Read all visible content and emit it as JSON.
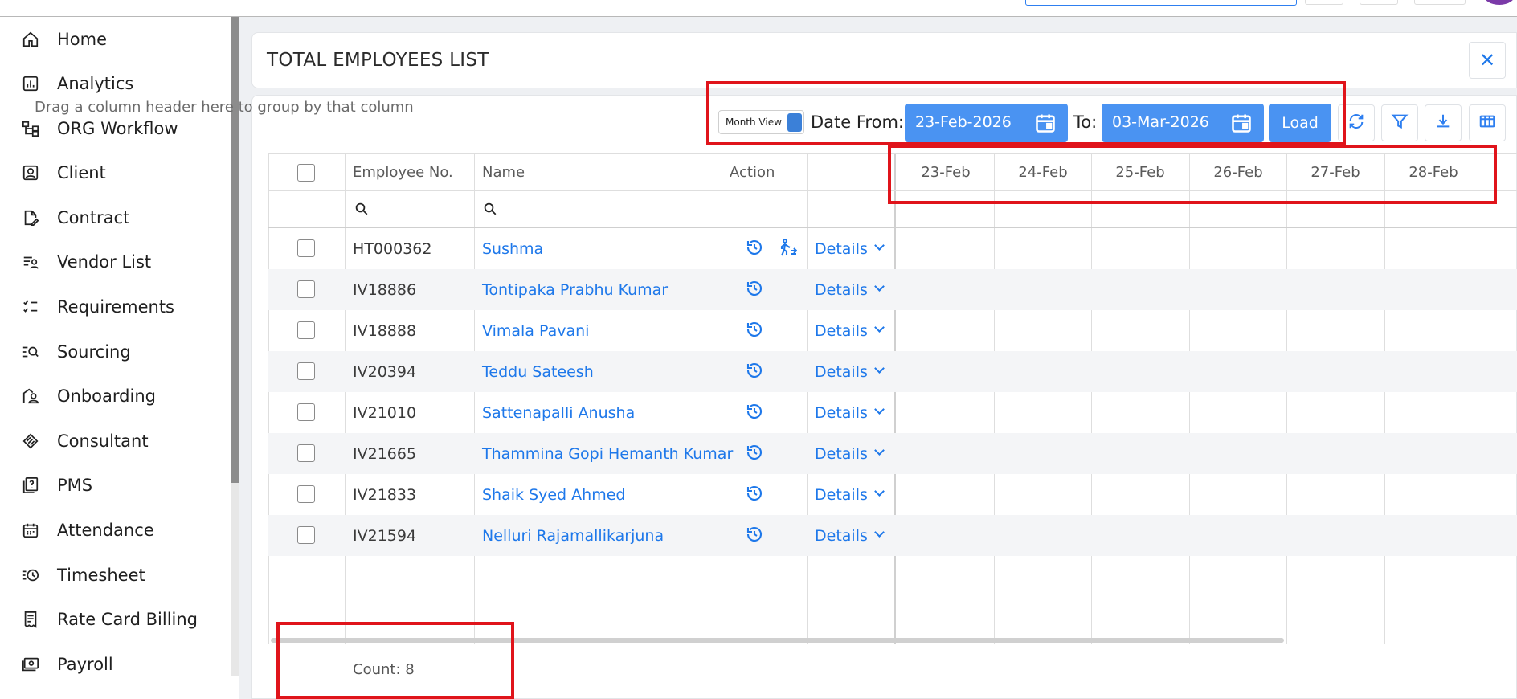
{
  "sidebar": {
    "items": [
      {
        "label": "Home",
        "icon": "home-icon"
      },
      {
        "label": "Analytics",
        "icon": "analytics-icon"
      },
      {
        "label": "ORG Workflow",
        "icon": "org-workflow-icon"
      },
      {
        "label": "Client",
        "icon": "client-icon"
      },
      {
        "label": "Contract",
        "icon": "contract-icon"
      },
      {
        "label": "Vendor List",
        "icon": "vendor-list-icon"
      },
      {
        "label": "Requirements",
        "icon": "requirements-icon"
      },
      {
        "label": "Sourcing",
        "icon": "sourcing-icon"
      },
      {
        "label": "Onboarding",
        "icon": "onboarding-icon"
      },
      {
        "label": "Consultant",
        "icon": "consultant-icon"
      },
      {
        "label": "PMS",
        "icon": "pms-icon"
      },
      {
        "label": "Attendance",
        "icon": "attendance-icon"
      },
      {
        "label": "Timesheet",
        "icon": "timesheet-icon"
      },
      {
        "label": "Rate Card Billing",
        "icon": "rate-card-billing-icon"
      },
      {
        "label": "Payroll",
        "icon": "payroll-icon"
      }
    ]
  },
  "page": {
    "title": "TOTAL EMPLOYEES LIST",
    "close_icon": "close-icon"
  },
  "toolbar": {
    "group_hint": "Drag a column header here to group by that column",
    "month_view_label": "Month View",
    "date_from_label": "Date From:",
    "date_from_value": "23-Feb-2026",
    "to_label": "To:",
    "to_value": "03-Mar-2026",
    "load_label": "Load",
    "tools": [
      "refresh-icon",
      "filter-icon",
      "download-icon",
      "column-chooser-icon"
    ]
  },
  "table": {
    "columns": {
      "employee_no": "Employee No.",
      "name": "Name",
      "action": "Action"
    },
    "date_columns": [
      "23-Feb",
      "24-Feb",
      "25-Feb",
      "26-Feb",
      "27-Feb",
      "28-Feb"
    ],
    "details_label": "Details",
    "rows": [
      {
        "emp_no": "HT000362",
        "name": "Sushma",
        "extra_action": true
      },
      {
        "emp_no": "IV18886",
        "name": "Tontipaka Prabhu Kumar",
        "extra_action": false
      },
      {
        "emp_no": "IV18888",
        "name": "Vimala Pavani",
        "extra_action": false
      },
      {
        "emp_no": "IV20394",
        "name": "Teddu Sateesh",
        "extra_action": false
      },
      {
        "emp_no": "IV21010",
        "name": "Sattenapalli Anusha",
        "extra_action": false
      },
      {
        "emp_no": "IV21665",
        "name": "Thammina Gopi Hemanth Kumar",
        "extra_action": false
      },
      {
        "emp_no": "IV21833",
        "name": "Shaik Syed Ahmed",
        "extra_action": false
      },
      {
        "emp_no": "IV21594",
        "name": "Nelluri Rajamallikarjuna",
        "extra_action": false
      }
    ],
    "count_label": "Count: 8"
  },
  "colors": {
    "accent": "#4a93f2",
    "link": "#1e78ea",
    "highlight": "#e0141b"
  }
}
